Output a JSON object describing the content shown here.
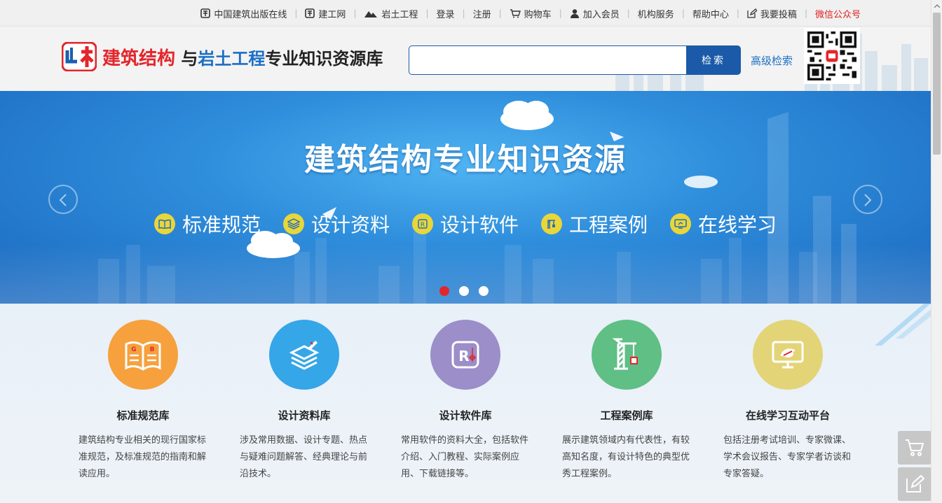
{
  "topnav": {
    "items": [
      {
        "label": "中国建筑出版在线",
        "icon": "publisher-logo-icon"
      },
      {
        "label": "建工网",
        "icon": "publisher-logo-icon"
      },
      {
        "label": "岩土工程",
        "icon": "mountain-icon"
      },
      {
        "label": "登录"
      },
      {
        "label": "注册"
      },
      {
        "label": "购物车",
        "icon": "cart-icon"
      },
      {
        "label": "加入会员",
        "icon": "user-icon"
      },
      {
        "label": "机构服务"
      },
      {
        "label": "帮助中心"
      },
      {
        "label": "我要投稿",
        "icon": "edit-icon"
      },
      {
        "label": "微信公众号",
        "color": "#e02020"
      }
    ]
  },
  "header": {
    "logo_part1": "建筑结构",
    "logo_part2": "与",
    "logo_part3": "岩土工程",
    "logo_part4": "专业知识资源库",
    "search_placeholder": "",
    "search_button": "检索",
    "advanced_search": "高级检索"
  },
  "banner": {
    "title": "建筑结构专业知识资源",
    "features": [
      {
        "label": "标准规范",
        "icon": "book-icon"
      },
      {
        "label": "设计资料",
        "icon": "layers-icon"
      },
      {
        "label": "设计软件",
        "icon": "software-icon"
      },
      {
        "label": "工程案例",
        "icon": "crane-icon"
      },
      {
        "label": "在线学习",
        "icon": "monitor-icon"
      }
    ],
    "active_slide": 1,
    "slide_count": 3
  },
  "modules": [
    {
      "title": "标准规范库",
      "desc": "建筑结构专业相关的现行国家标准规范，及标准规范的指南和解读应用。",
      "color": "#f6a13d",
      "icon": "gb-book-icon"
    },
    {
      "title": "设计资料库",
      "desc": "涉及常用数据、设计专题、热点与疑难问题解答、经典理论与前沿技术。",
      "color": "#35a6e8",
      "icon": "layers-icon"
    },
    {
      "title": "设计软件库",
      "desc": "常用软件的资料大全，包括软件介绍、入门教程、实际案例应用、下载链接等。",
      "color": "#9b8ec9",
      "icon": "software-r-icon"
    },
    {
      "title": "工程案例库",
      "desc": "展示建筑领域内有代表性，有较高知名度，有设计特色的典型优秀工程案例。",
      "color": "#5fbf85",
      "icon": "crane-icon"
    },
    {
      "title": "在线学习互动平台",
      "desc": "包括注册考试培训、专家微课、学术会议报告、专家学者访谈和专家答疑。",
      "color": "#e3d478",
      "icon": "monitor-icon"
    }
  ],
  "colors": {
    "brand_red": "#e3262b",
    "brand_blue": "#1a5aa8",
    "link_blue": "#1b6fc4"
  }
}
